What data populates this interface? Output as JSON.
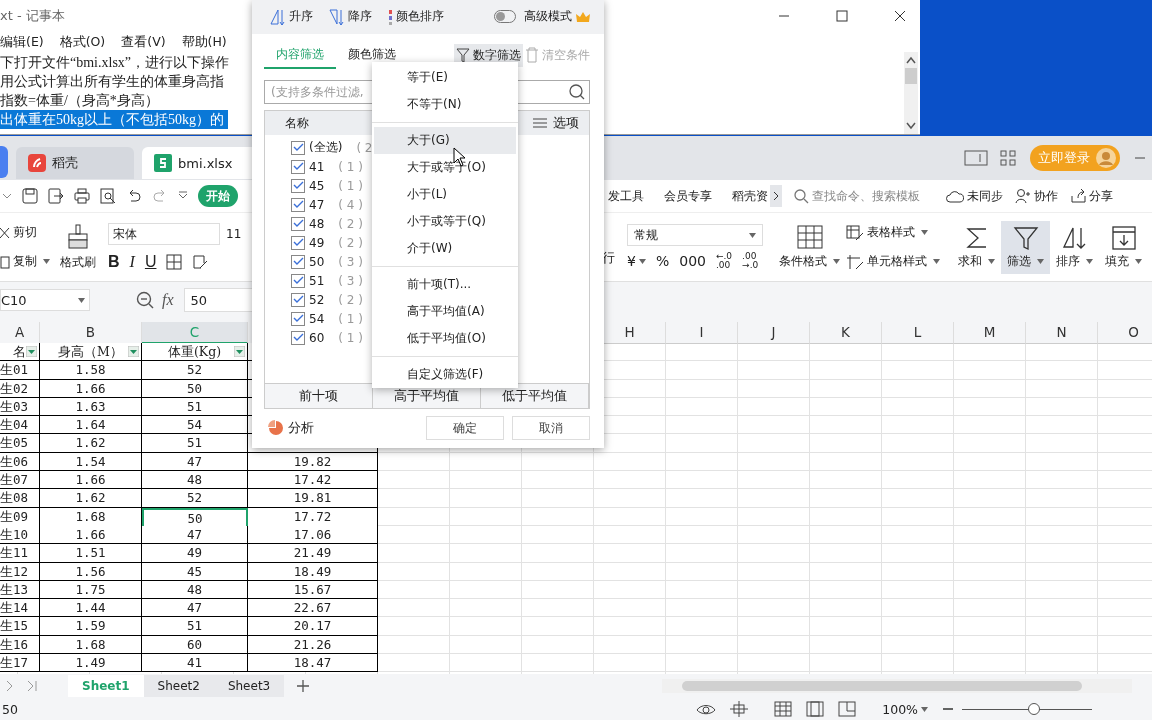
{
  "notepad": {
    "title": "xt - 记事本",
    "menu": [
      "编辑(E)",
      "格式(O)",
      "查看(V)",
      "帮助(H)"
    ],
    "lines": [
      {
        "text": "下打开文件“bmi.xlsx”，进行以下操作",
        "selected": false
      },
      {
        "text": "用公式计算出所有学生的体重身高指",
        "selected": false
      },
      {
        "text": "指数=体重/（身高*身高）",
        "selected": false
      },
      {
        "text": "出体重在50kg以上（不包括50kg）的",
        "selected": true
      }
    ]
  },
  "spreadsheet_app": {
    "tabs": [
      {
        "label": "稻壳",
        "selected": false
      },
      {
        "label": "bmi.xlsx",
        "selected": true
      }
    ],
    "login_button": "立即登录",
    "start_tab": "开始",
    "menu_tabs": [
      "发工具",
      "会员专享",
      "稻壳资"
    ],
    "search": {
      "placeholder": "查找命令、搜索模板"
    },
    "header_actions": [
      "未同步",
      "协作",
      "分享"
    ],
    "ribbon": {
      "cut": "剪切",
      "copy": "复制",
      "format_painter": "格式刷",
      "font": "宋体",
      "font_size": "11",
      "text_styles": [
        "B",
        "I",
        "U"
      ],
      "wrap_label": "行",
      "number_format": "常规",
      "currency": "¥",
      "percent": "%",
      "thousands": "000",
      "decimal_increase": [
        "←.0",
        ".00"
      ],
      "decimal_decrease": [
        ".00",
        "→.0"
      ],
      "conditional_format": "条件格式",
      "table_style": "表格样式",
      "cell_style": "单元格样式",
      "tools": [
        {
          "label": "求和",
          "kind": "sum",
          "selected": false
        },
        {
          "label": "筛选",
          "kind": "filter",
          "selected": true
        },
        {
          "label": "排序",
          "kind": "sort",
          "selected": false
        },
        {
          "label": "填充",
          "kind": "fill",
          "selected": false
        }
      ]
    },
    "formula_bar": {
      "cell": "C10",
      "fx": "fx",
      "value": "50"
    },
    "columns": [
      {
        "label": "A",
        "selected": false
      },
      {
        "label": "B",
        "selected": false
      },
      {
        "label": "C",
        "selected": true
      },
      {
        "label": "H",
        "selected": false
      },
      {
        "label": "I",
        "selected": false
      },
      {
        "label": "J",
        "selected": false
      },
      {
        "label": "K",
        "selected": false
      },
      {
        "label": "L",
        "selected": false
      },
      {
        "label": "M",
        "selected": false
      },
      {
        "label": "N",
        "selected": false
      },
      {
        "label": "O",
        "selected": false
      }
    ],
    "table_header": [
      "名",
      "身高（M）",
      "体重(Kg)"
    ],
    "rows": [
      {
        "cells": [
          "生01",
          "1.58",
          "52"
        ],
        "selected": false
      },
      {
        "cells": [
          "生02",
          "1.66",
          "50"
        ],
        "selected": false
      },
      {
        "cells": [
          "生03",
          "1.63",
          "51"
        ],
        "selected": false
      },
      {
        "cells": [
          "生04",
          "1.64",
          "54"
        ],
        "selected": false
      },
      {
        "cells": [
          "生05",
          "1.62",
          "51"
        ],
        "selected": false
      },
      {
        "cells": [
          "生06",
          "1.54",
          "47",
          "19.82"
        ],
        "selected": false
      },
      {
        "cells": [
          "生07",
          "1.66",
          "48",
          "17.42"
        ],
        "selected": false
      },
      {
        "cells": [
          "生08",
          "1.62",
          "52",
          "19.81"
        ],
        "selected": false
      },
      {
        "cells": [
          "生09",
          "1.68",
          "50",
          "17.72"
        ],
        "selected": true
      },
      {
        "cells": [
          "生10",
          "1.66",
          "47",
          "17.06"
        ],
        "selected": false
      },
      {
        "cells": [
          "生11",
          "1.51",
          "49",
          "21.49"
        ],
        "selected": false
      },
      {
        "cells": [
          "生12",
          "1.56",
          "45",
          "18.49"
        ],
        "selected": false
      },
      {
        "cells": [
          "生13",
          "1.75",
          "48",
          "15.67"
        ],
        "selected": false
      },
      {
        "cells": [
          "生14",
          "1.44",
          "47",
          "22.67"
        ],
        "selected": false
      },
      {
        "cells": [
          "生15",
          "1.59",
          "51",
          "20.17"
        ],
        "selected": false
      },
      {
        "cells": [
          "生16",
          "1.68",
          "60",
          "21.26"
        ],
        "selected": false
      },
      {
        "cells": [
          "生17",
          "1.49",
          "41",
          "18.47"
        ],
        "selected": false
      }
    ],
    "sheets": [
      {
        "label": "Sheet1",
        "selected": true
      },
      {
        "label": "Sheet2",
        "selected": false
      },
      {
        "label": "Sheet3",
        "selected": false
      }
    ],
    "status": "50",
    "zoom": {
      "label": "100%",
      "level": 0.55
    }
  },
  "filter_popup": {
    "sort_buttons": [
      "升序",
      "降序",
      "颜色排序"
    ],
    "advanced_mode": {
      "label": "高级模式",
      "on": false
    },
    "tabs": [
      {
        "label": "内容筛选",
        "selected": true
      },
      {
        "label": "颜色筛选",
        "selected": false
      }
    ],
    "number_filter": {
      "label": "数字筛选",
      "selected": true
    },
    "clear": {
      "label": "清空条件",
      "disabled": true
    },
    "search": {
      "placeholder": "(支持多条件过滤,"
    },
    "list_header": "名称",
    "options": "选项",
    "items": [
      {
        "value": "(全选)",
        "count": "( 2",
        "checked": true
      },
      {
        "value": "41",
        "count": "( 1 )",
        "checked": true
      },
      {
        "value": "45",
        "count": "( 1 )",
        "checked": true
      },
      {
        "value": "47",
        "count": "( 4 )",
        "checked": true
      },
      {
        "value": "48",
        "count": "( 2 )",
        "checked": true
      },
      {
        "value": "49",
        "count": "( 2 )",
        "checked": true
      },
      {
        "value": "50",
        "count": "( 3 )",
        "checked": true
      },
      {
        "value": "51",
        "count": "( 3 )",
        "checked": true
      },
      {
        "value": "52",
        "count": "( 2 )",
        "checked": true
      },
      {
        "value": "54",
        "count": "( 1 )",
        "checked": true
      },
      {
        "value": "60",
        "count": "( 1 )",
        "checked": true
      }
    ],
    "quick_buttons": [
      "前十项",
      "高于平均值",
      "低于平均值"
    ],
    "analysis": "分析",
    "ok": "确定",
    "cancel": "取消"
  },
  "number_filter_menu": {
    "groups": [
      [
        {
          "label": "等于(E)",
          "selected": false
        },
        {
          "label": "不等于(N)",
          "selected": false
        }
      ],
      [
        {
          "label": "大于(G)",
          "selected": true
        },
        {
          "label": "大于或等于(O)",
          "selected": false
        },
        {
          "label": "小于(L)",
          "selected": false
        },
        {
          "label": "小于或等于(Q)",
          "selected": false
        },
        {
          "label": "介于(W)",
          "selected": false
        }
      ],
      [
        {
          "label": "前十项(T)...",
          "selected": false
        },
        {
          "label": "高于平均值(A)",
          "selected": false
        },
        {
          "label": "低于平均值(O)",
          "selected": false
        }
      ],
      [
        {
          "label": "自定义筛选(F)",
          "selected": false
        }
      ]
    ]
  }
}
